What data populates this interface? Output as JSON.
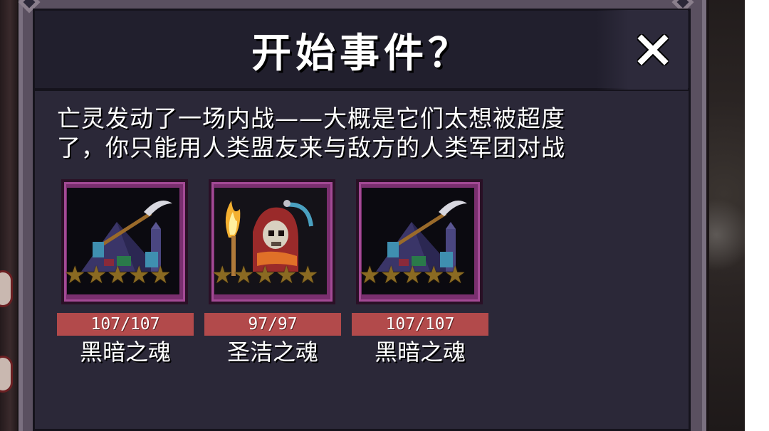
{
  "dialog": {
    "title": "开始事件？",
    "description_line1": "亡灵发动了一场内战——大概是它们太想被超度",
    "description_line2": "了，你只能用人类盟友来与敌方的人类军团对战"
  },
  "cards": [
    {
      "name": "黑暗之魂",
      "hp": "107/107",
      "stars": 5,
      "art": "dark-soul-scythe-pyramid"
    },
    {
      "name": "圣洁之魂",
      "hp": "97/97",
      "stars": 5,
      "art": "holy-soul-hooded-skull-torch"
    },
    {
      "name": "黑暗之魂",
      "hp": "107/107",
      "stars": 5,
      "art": "dark-soul-scythe-pyramid"
    }
  ],
  "colors": {
    "hp_bar": "#b24a4b",
    "card_frame": "#7a2f6f",
    "dialog_bg": "#2b2838",
    "header_bg": "#211f2d"
  },
  "icons": {
    "close": "close-icon",
    "star": "star-icon"
  }
}
